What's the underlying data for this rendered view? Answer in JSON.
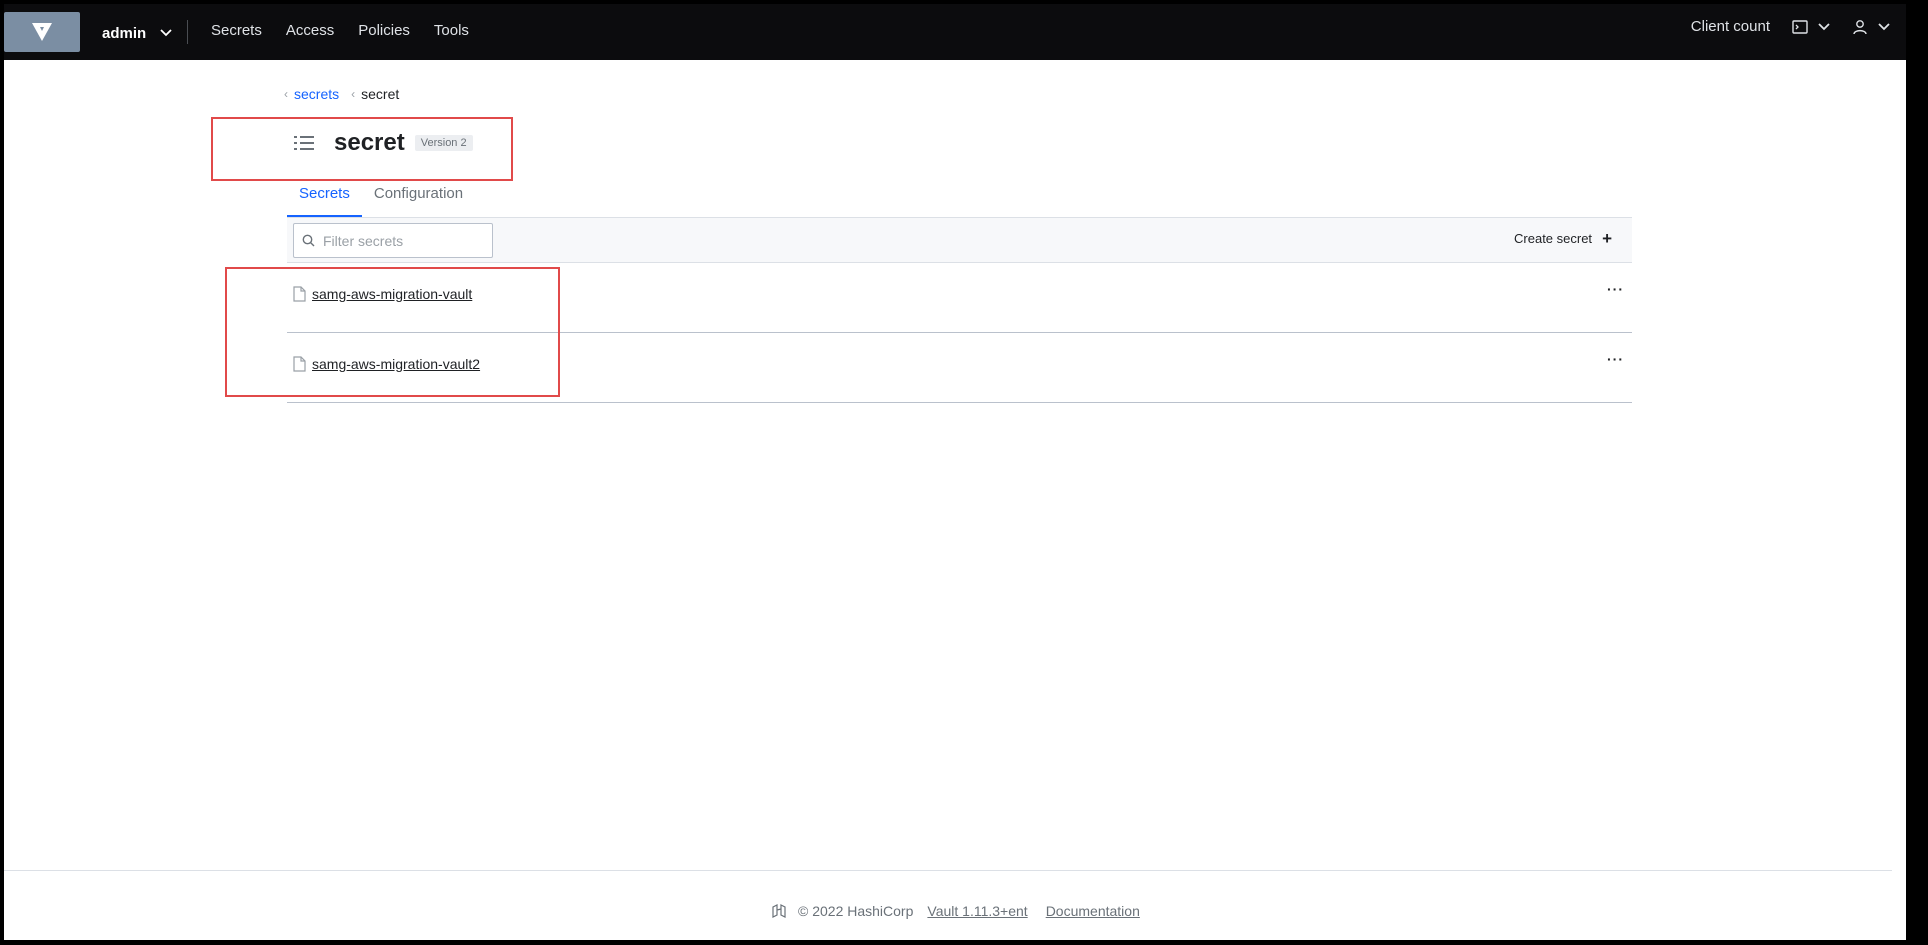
{
  "nav": {
    "namespace": "admin",
    "links": [
      "Secrets",
      "Access",
      "Policies",
      "Tools"
    ],
    "client_count": "Client count"
  },
  "breadcrumb": {
    "parent": "secrets",
    "current": "secret"
  },
  "header": {
    "title": "secret",
    "version": "Version 2"
  },
  "tabs": [
    "Secrets",
    "Configuration"
  ],
  "toolbar": {
    "filter_placeholder": "Filter secrets",
    "create_label": "Create secret",
    "create_icon": "+"
  },
  "secrets": [
    {
      "name": "samg-aws-migration-vault"
    },
    {
      "name": "samg-aws-migration-vault2"
    }
  ],
  "more_glyph": "···",
  "footer": {
    "copyright": "© 2022 HashiCorp",
    "version": "Vault 1.11.3+ent",
    "docs": "Documentation"
  },
  "colors": {
    "nav_bg": "#0c0c0e",
    "accent": "#1563ff",
    "highlight": "#e14a4a"
  },
  "icons": [
    "vault-logo-icon",
    "chevron-down-icon",
    "terminal-icon",
    "user-icon",
    "list-icon",
    "search-icon",
    "file-icon",
    "hashicorp-logo-icon"
  ]
}
